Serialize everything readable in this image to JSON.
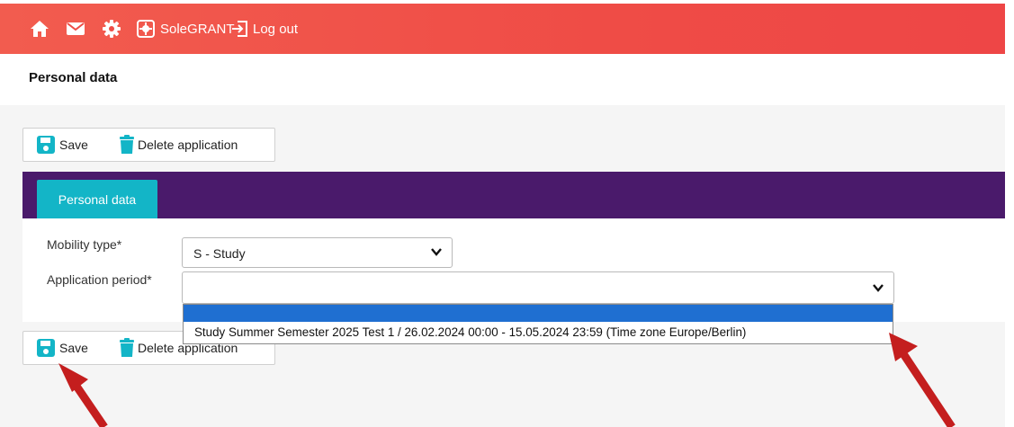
{
  "topbar": {
    "icons": [
      "home-icon",
      "mail-icon",
      "gear-icon"
    ],
    "brand_label": "SoleGRANT",
    "logout_label": "Log out"
  },
  "page": {
    "title": "Personal data"
  },
  "toolbar": {
    "save_label": "Save",
    "delete_label": "Delete application"
  },
  "tabs": [
    {
      "label": "Personal data",
      "active": true
    }
  ],
  "form": {
    "mobility_type": {
      "label": "Mobility type*",
      "value": "S - Study"
    },
    "application_period": {
      "label": "Application period*",
      "value": "",
      "options": [
        "",
        "Study Summer Semester 2025 Test 1 / 26.02.2024 00:00 - 15.05.2024 23:59 (Time zone Europe/Berlin)"
      ]
    }
  },
  "colors": {
    "topbar": "#ef4c46",
    "tab_bar": "#4a1a6b",
    "tab_active": "#13b5c7",
    "icon_accent": "#13b5c7",
    "selected_option": "#1f6fd1",
    "annotation_arrow": "#c41e1e"
  },
  "annotations": [
    "arrow-pointing-save",
    "arrow-pointing-dropdown-option"
  ]
}
